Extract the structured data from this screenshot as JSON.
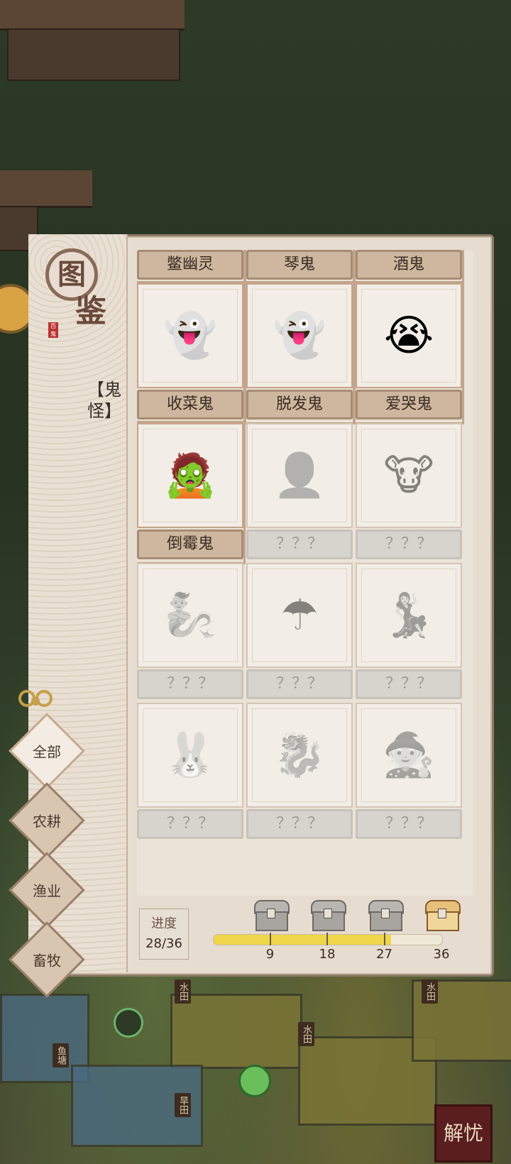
{
  "background": {
    "signs": [
      "水田",
      "水田",
      "水田",
      "鱼塘",
      "旱田"
    ],
    "corner_badge": "解忧"
  },
  "book": {
    "logo_main": "图",
    "logo_sub": "鉴",
    "seal_text": "百鬼",
    "category": "【鬼怪】"
  },
  "cards": [
    {
      "name": "鳖幽灵",
      "unlocked": true,
      "icon": "ghost-icon",
      "glyph": ""
    },
    {
      "name": "琴鬼",
      "unlocked": true,
      "icon": "ghost-icon",
      "glyph": ""
    },
    {
      "name": "酒鬼",
      "unlocked": true,
      "icon": "ghost-icon",
      "glyph": ""
    },
    {
      "name": "收菜鬼",
      "unlocked": true,
      "icon": "farmer-ghost-icon",
      "glyph": "👻"
    },
    {
      "name": "脱发鬼",
      "unlocked": true,
      "icon": "scholar-ghost-icon",
      "glyph": "👻"
    },
    {
      "name": "爱哭鬼",
      "unlocked": true,
      "icon": "crying-ghost-icon",
      "glyph": "😭"
    },
    {
      "name": "倒霉鬼",
      "unlocked": true,
      "icon": "unlucky-ghost-icon",
      "glyph": "🧟"
    },
    {
      "name": "？？？",
      "unlocked": false,
      "icon": "locked-ghost-icon",
      "glyph": "👤"
    },
    {
      "name": "？？？",
      "unlocked": false,
      "icon": "locked-ghost-icon",
      "glyph": "🐮"
    },
    {
      "name": "？？？",
      "unlocked": false,
      "icon": "locked-ghost-icon",
      "glyph": "🧞"
    },
    {
      "name": "？？？",
      "unlocked": false,
      "icon": "locked-ghost-icon",
      "glyph": "☂"
    },
    {
      "name": "？？？",
      "unlocked": false,
      "icon": "locked-ghost-icon",
      "glyph": "💃"
    },
    {
      "name": "？？？",
      "unlocked": false,
      "icon": "locked-ghost-icon",
      "glyph": "🐰"
    },
    {
      "name": "？？？",
      "unlocked": false,
      "icon": "locked-ghost-icon",
      "glyph": "🐉"
    },
    {
      "name": "？？？",
      "unlocked": false,
      "icon": "locked-ghost-icon",
      "glyph": "🧙"
    }
  ],
  "tabs": [
    {
      "label": "全部",
      "active": true
    },
    {
      "label": "农耕",
      "active": false
    },
    {
      "label": "渔业",
      "active": false
    },
    {
      "label": "畜牧",
      "active": false
    }
  ],
  "progress": {
    "label": "进度",
    "value_text": "28/36",
    "current": 28,
    "total": 36,
    "milestones": [
      "9",
      "18",
      "27",
      "36"
    ]
  },
  "colors": {
    "bar_fill": "#f0d64a",
    "panel_bg": "#e6ddd0",
    "card_name_bg": "#cdb79e"
  }
}
